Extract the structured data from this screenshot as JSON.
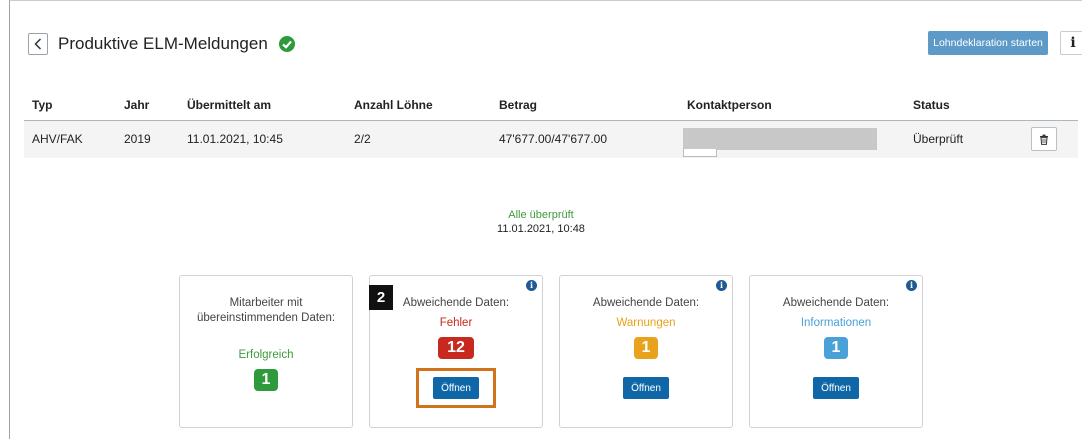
{
  "header": {
    "back_icon": "chevron-left-icon",
    "title": "Produktive ELM-Meldungen",
    "status_icon": "check-circle-icon",
    "start_button": "Lohndeklaration starten",
    "info_button": "i"
  },
  "table": {
    "columns": [
      "Typ",
      "Jahr",
      "Übermittelt am",
      "Anzahl Löhne",
      "Betrag",
      "Kontaktperson",
      "Status"
    ],
    "row": {
      "typ": "AHV/FAK",
      "jahr": "2019",
      "uebermittelt": "11.01.2021, 10:45",
      "anzahl": "2/2",
      "betrag": "47'677.00/47'677.00",
      "kontakt": "",
      "status": "Überprüft",
      "delete_icon": "trash-icon"
    }
  },
  "summary": {
    "status": "Alle überprüft",
    "date": "11.01.2021, 10:48"
  },
  "cards": {
    "matching": {
      "line1": "Mitarbeiter mit",
      "line2": "übereinstimmenden Daten:",
      "kind": "Erfolgreich",
      "count": "1",
      "color": "#2e9a3c"
    },
    "errors": {
      "line1": "Abweichende Daten:",
      "kind": "Fehler",
      "count": "12",
      "color": "#c8281e",
      "button": "Öffnen"
    },
    "warnings": {
      "line1": "Abweichende Daten:",
      "kind": "Warnungen",
      "count": "1",
      "color": "#e8a21b",
      "button": "Öffnen"
    },
    "infos": {
      "line1": "Abweichende Daten:",
      "kind": "Informationen",
      "count": "1",
      "color": "#4aa1d8",
      "button": "Öffnen"
    }
  },
  "annotation": {
    "step": "2",
    "highlight_color": "#d0731b"
  }
}
